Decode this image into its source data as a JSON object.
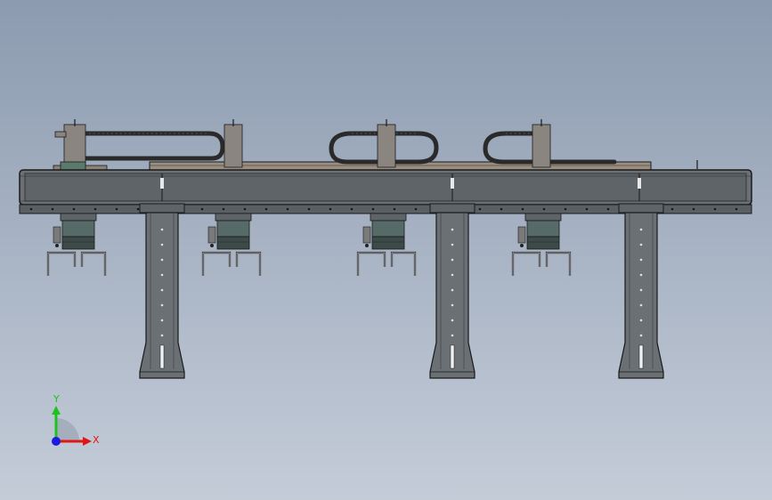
{
  "viewport": {
    "background_top": "#8c9bb0",
    "background_bottom": "#c4ccd8"
  },
  "model": {
    "frame_color": "#5f6468",
    "outline_color": "#1a1a1a",
    "beam_color": "#6b7074",
    "gripper_color": "#566b68",
    "chain_color": "#2a2a2a",
    "rail_color": "#9a8e80"
  },
  "triad": {
    "x_label": "X",
    "y_label": "Y",
    "x_color": "#e01515",
    "y_color": "#1ec21e",
    "z_color": "#1a1ae0"
  }
}
